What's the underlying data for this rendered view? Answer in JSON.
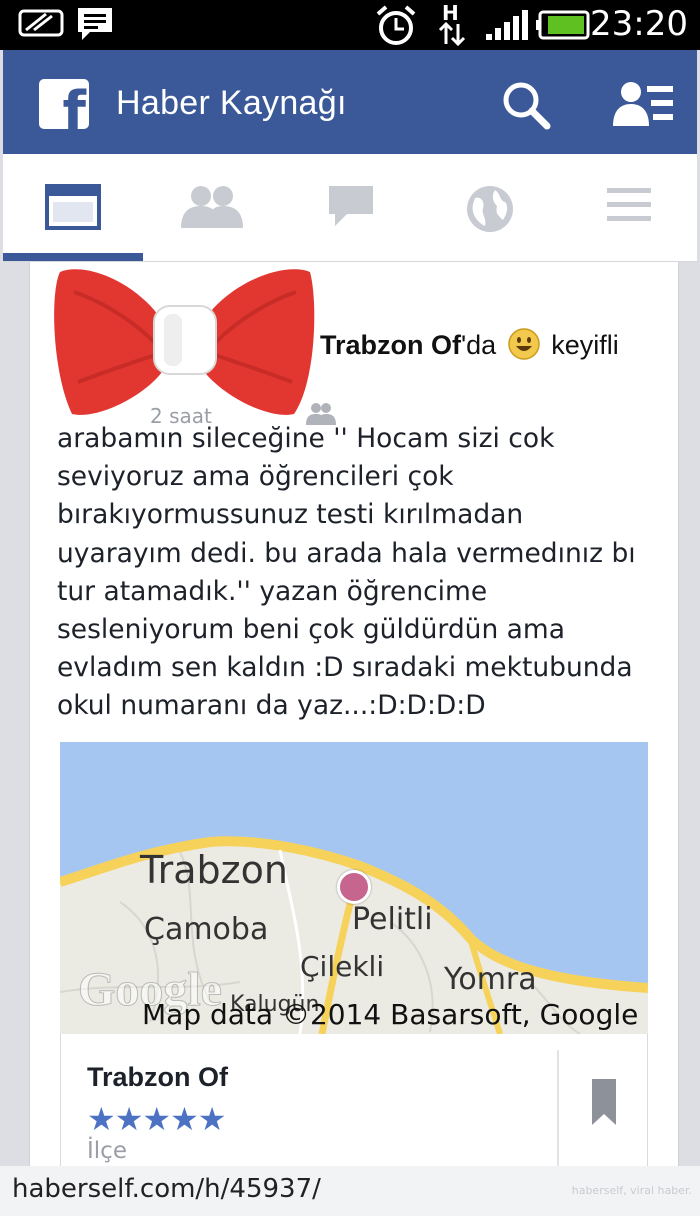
{
  "status_bar": {
    "time": "23:20",
    "icons": [
      "notification-icon",
      "message-icon",
      "alarm-icon",
      "network-h-icon",
      "signal-icon",
      "battery-icon"
    ]
  },
  "app_bar": {
    "title": "Haber Kaynağı",
    "logo_letter": "f",
    "icons": [
      "facebook-logo-icon",
      "search-icon",
      "friend-requests-icon"
    ],
    "background_color": "#3b5998"
  },
  "tabs": [
    {
      "name": "news-feed",
      "icon": "news-feed-icon",
      "active": true
    },
    {
      "name": "friends",
      "icon": "friends-icon",
      "active": false
    },
    {
      "name": "messages",
      "icon": "messages-icon",
      "active": false
    },
    {
      "name": "notifications",
      "icon": "globe-icon",
      "active": false
    },
    {
      "name": "more",
      "icon": "menu-icon",
      "active": false
    }
  ],
  "post": {
    "location_name": "Trabzon Of",
    "location_suffix": "'da",
    "feeling": "keyifli",
    "time_fragment": "2 saat",
    "body": "arabamın sileceğine '' Hocam sizi cok\nseviyoruz ama öğrencileri çok\nbırakıyormussunuz testi kırılmadan\nuyarayım dedi. bu arada hala vermedınız bı\ntur atamadık.'' yazan öğrencime\nsesleniyorum beni çok güldürdün ama\nevladım sen kaldın :D sıradaki mektubunda\nokul numaranı da yaz...:D:D:D:D"
  },
  "map": {
    "labels": {
      "trabzon": "Trabzon",
      "camoba": "Çamoba",
      "pelitli": "Pelitli",
      "cilekli": "Çilekli",
      "yomra": "Yomra",
      "kulugun": "Kalugün"
    },
    "watermark": "Google",
    "attribution": "Map data ©2014 Basarsoft, Google"
  },
  "place": {
    "name": "Trabzon Of",
    "rating": 4.5,
    "stars": "★★★★★",
    "type": "İlçe"
  },
  "footer": {
    "url": "haberself.com/h/45937/",
    "brand": "haberself, viral haber."
  }
}
